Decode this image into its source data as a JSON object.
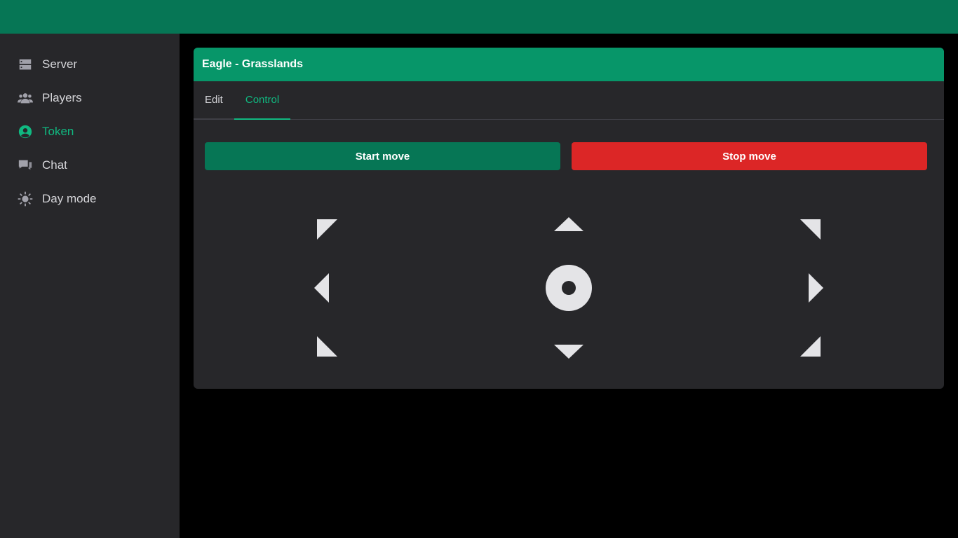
{
  "sidebar": {
    "items": [
      {
        "label": "Server",
        "icon": "server-icon"
      },
      {
        "label": "Players",
        "icon": "users-icon"
      },
      {
        "label": "Token",
        "icon": "user-circle-icon",
        "active": true
      },
      {
        "label": "Chat",
        "icon": "chat-icon"
      },
      {
        "label": "Day mode",
        "icon": "sun-icon"
      }
    ]
  },
  "panel": {
    "title": "Eagle - Grasslands",
    "tabs": [
      {
        "label": "Edit"
      },
      {
        "label": "Control",
        "active": true
      }
    ],
    "start_label": "Start move",
    "stop_label": "Stop move"
  },
  "colors": {
    "topbar": "#067655",
    "header": "#079669",
    "accent": "#10b981",
    "stop": "#dc2626",
    "panel": "#27272a",
    "control": "#e4e4e7"
  }
}
